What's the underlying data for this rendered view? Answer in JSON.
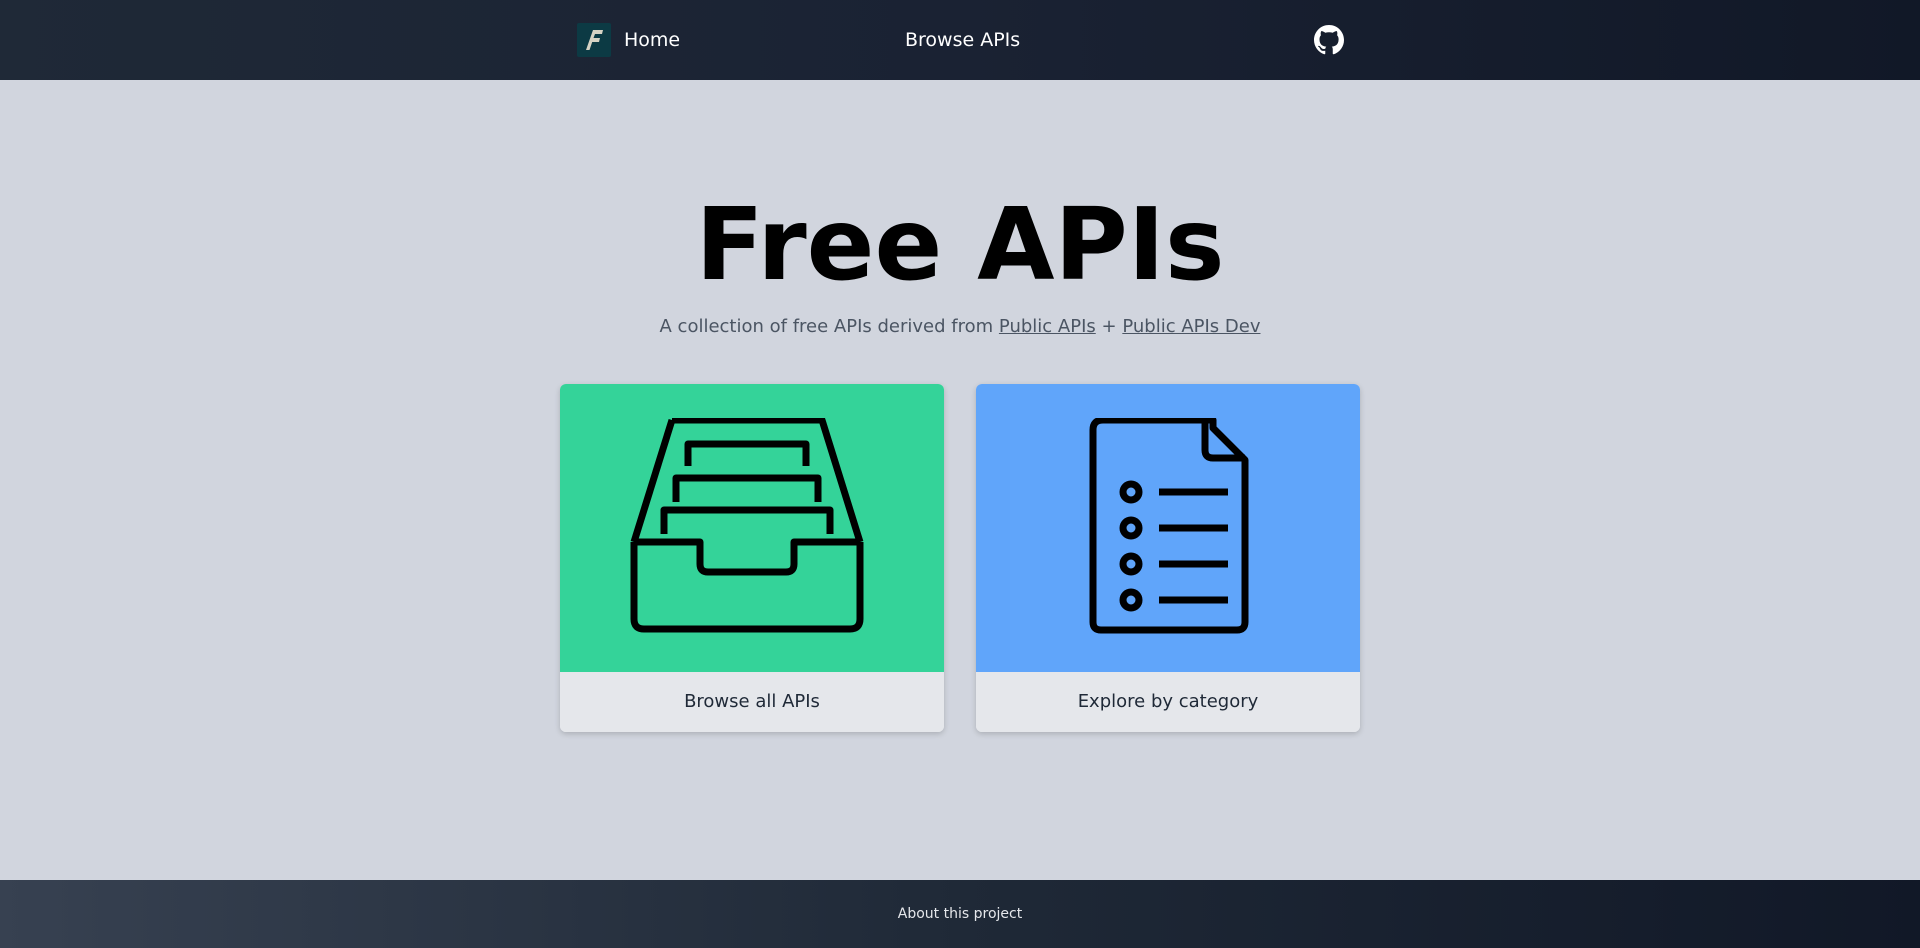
{
  "nav": {
    "home_label": "Home",
    "browse_label": "Browse APIs",
    "logo_letter": "F",
    "github_icon": "github-icon"
  },
  "hero": {
    "title": "Free APIs",
    "subtitle_prefix": "A collection of free APIs derived from",
    "link1": "Public APIs",
    "separator": "+",
    "link2": "Public APIs Dev"
  },
  "cards": [
    {
      "label": "Browse all APIs",
      "icon": "inbox-stack-icon",
      "color": "#34d399"
    },
    {
      "label": "Explore by category",
      "icon": "document-list-icon",
      "color": "#60a5fa"
    }
  ],
  "footer": {
    "about_label": "About this project"
  },
  "colors": {
    "nav_bg": "#1f2937",
    "page_bg": "#d1d5de",
    "browse_card": "#34d399",
    "explore_card": "#60a5fa"
  }
}
